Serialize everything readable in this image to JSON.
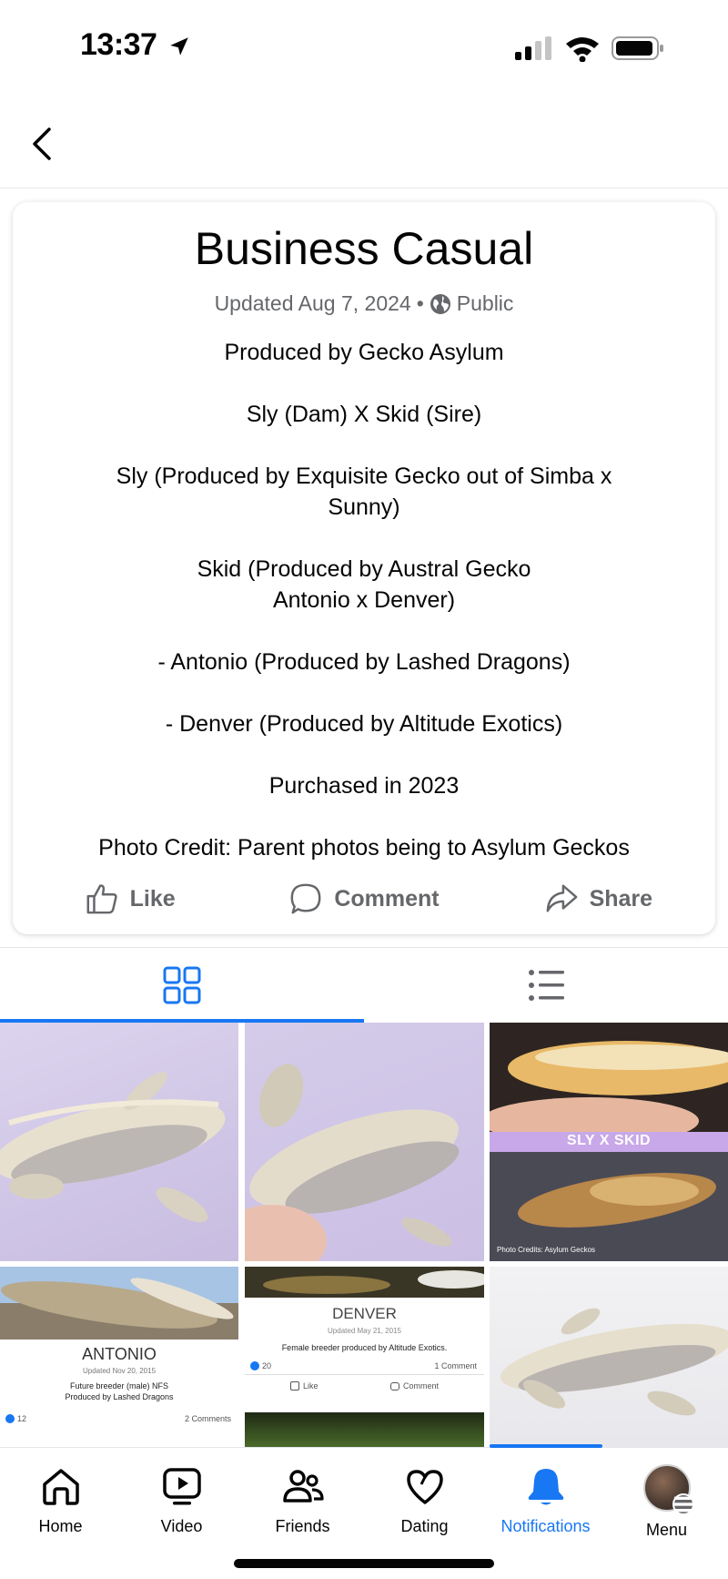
{
  "status_bar": {
    "time": "13:37"
  },
  "album": {
    "title": "Business Casual",
    "updated": "Updated Aug 7, 2024",
    "separator": "•",
    "privacy": "Public",
    "description": [
      "Produced by Gecko Asylum",
      "Sly (Dam) X Skid (Sire)",
      "Sly (Produced by Exquisite Gecko out of Simba x Sunny)",
      "Skid (Produced by Austral Gecko Antonio x Denver)",
      "- Antonio (Produced by Lashed Dragons)",
      "- Denver (Produced by Altitude Exotics)",
      "Purchased in 2023",
      "Photo Credit: Parent photos being to Asylum Geckos"
    ]
  },
  "actions": {
    "like": "Like",
    "comment": "Comment",
    "share": "Share"
  },
  "photos": {
    "p3_label": "SLY X SKID",
    "p3_credit": "Photo Credits: Asylum Geckos",
    "antonio": {
      "name": "ANTONIO",
      "updated": "Updated Nov 20, 2015",
      "line1": "Future breeder (male) NFS",
      "line2": "Produced by Lashed Dragons",
      "reactions": "12",
      "comments": "2 Comments"
    },
    "denver": {
      "name": "DENVER",
      "updated": "Updated May 21, 2015",
      "line1": "Female breeder produced by Altitude Exotics.",
      "reactions": "20",
      "comments": "1 Comment",
      "like": "Like",
      "comment": "Comment"
    }
  },
  "bottom_nav": {
    "home": "Home",
    "video": "Video",
    "friends": "Friends",
    "dating": "Dating",
    "notifications": "Notifications",
    "menu": "Menu"
  },
  "colors": {
    "accent": "#1877f2",
    "secondary_text": "#65676b",
    "divider": "#e4e6eb"
  }
}
